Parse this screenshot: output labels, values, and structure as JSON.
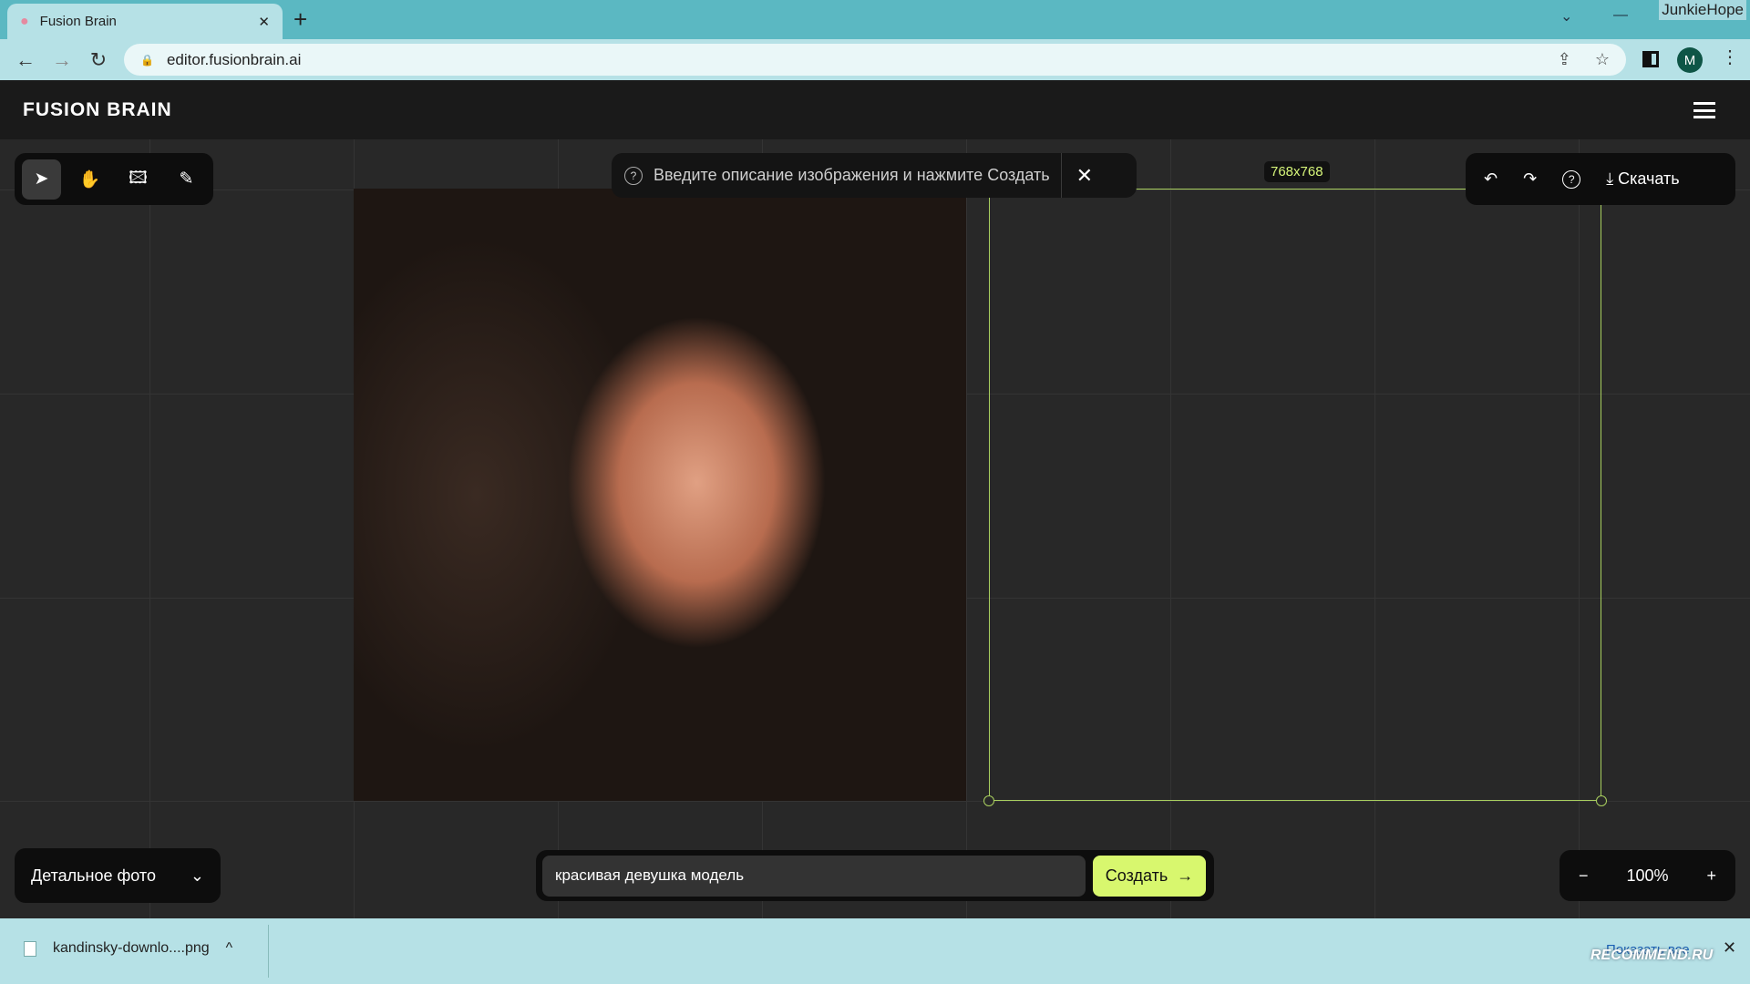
{
  "browser": {
    "tab_title": "Fusion Brain",
    "url": "editor.fusionbrain.ai",
    "profile_initial": "M",
    "watermark_user": "JunkieHope"
  },
  "app": {
    "logo": "FUSION BRAIN",
    "tools": [
      "select-icon",
      "hand-icon",
      "add-image-icon",
      "eraser-icon"
    ],
    "hint": "Введите описание изображения и нажмите Создать",
    "frame_size": "768x768",
    "download_label": "Скачать",
    "style_selected": "Детальное фото",
    "prompt_value": "красивая девушка модель",
    "create_label": "Создать",
    "zoom_level": "100%",
    "accent_color": "#d8f76e"
  },
  "downloads": {
    "file_name": "kandinsky-downlo....png",
    "show_all": "Показать все",
    "watermark": "RECOMMEND.RU"
  }
}
